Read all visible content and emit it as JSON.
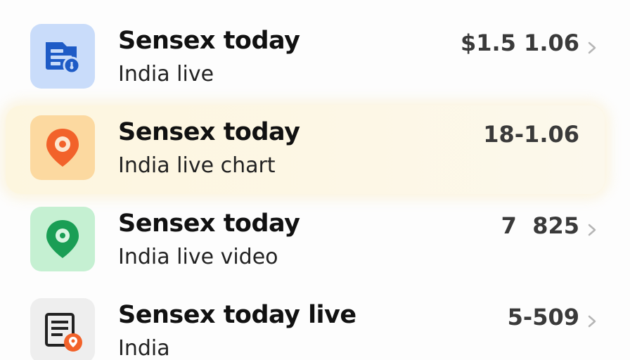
{
  "colors": {
    "tile_blue": "#c9dcfa",
    "tile_orange": "#fcd9a0",
    "tile_green": "#c5f0d2",
    "tile_gray": "#eeeeee",
    "icon_blue": "#1e5bc6",
    "icon_orange": "#f2622a",
    "icon_green": "#1a9e55",
    "icon_dark": "#222222",
    "highlight": "#fdf6df"
  },
  "items": [
    {
      "icon": "document-bookmark-icon",
      "title": "Sensex today",
      "subtitle": "India live",
      "value": "$1.5 1.06",
      "has_chevron": true,
      "highlighted": false
    },
    {
      "icon": "map-pin-icon",
      "title": "Sensex today",
      "subtitle": "India live chart",
      "value": "18-1.06",
      "has_chevron": false,
      "highlighted": true
    },
    {
      "icon": "map-pin-icon",
      "title": "Sensex today",
      "subtitle": "India live video",
      "value": "7  825",
      "has_chevron": true,
      "highlighted": false
    },
    {
      "icon": "document-location-icon",
      "title": "Sensex today live",
      "subtitle": "India",
      "value": "5-509",
      "has_chevron": true,
      "highlighted": false
    }
  ]
}
